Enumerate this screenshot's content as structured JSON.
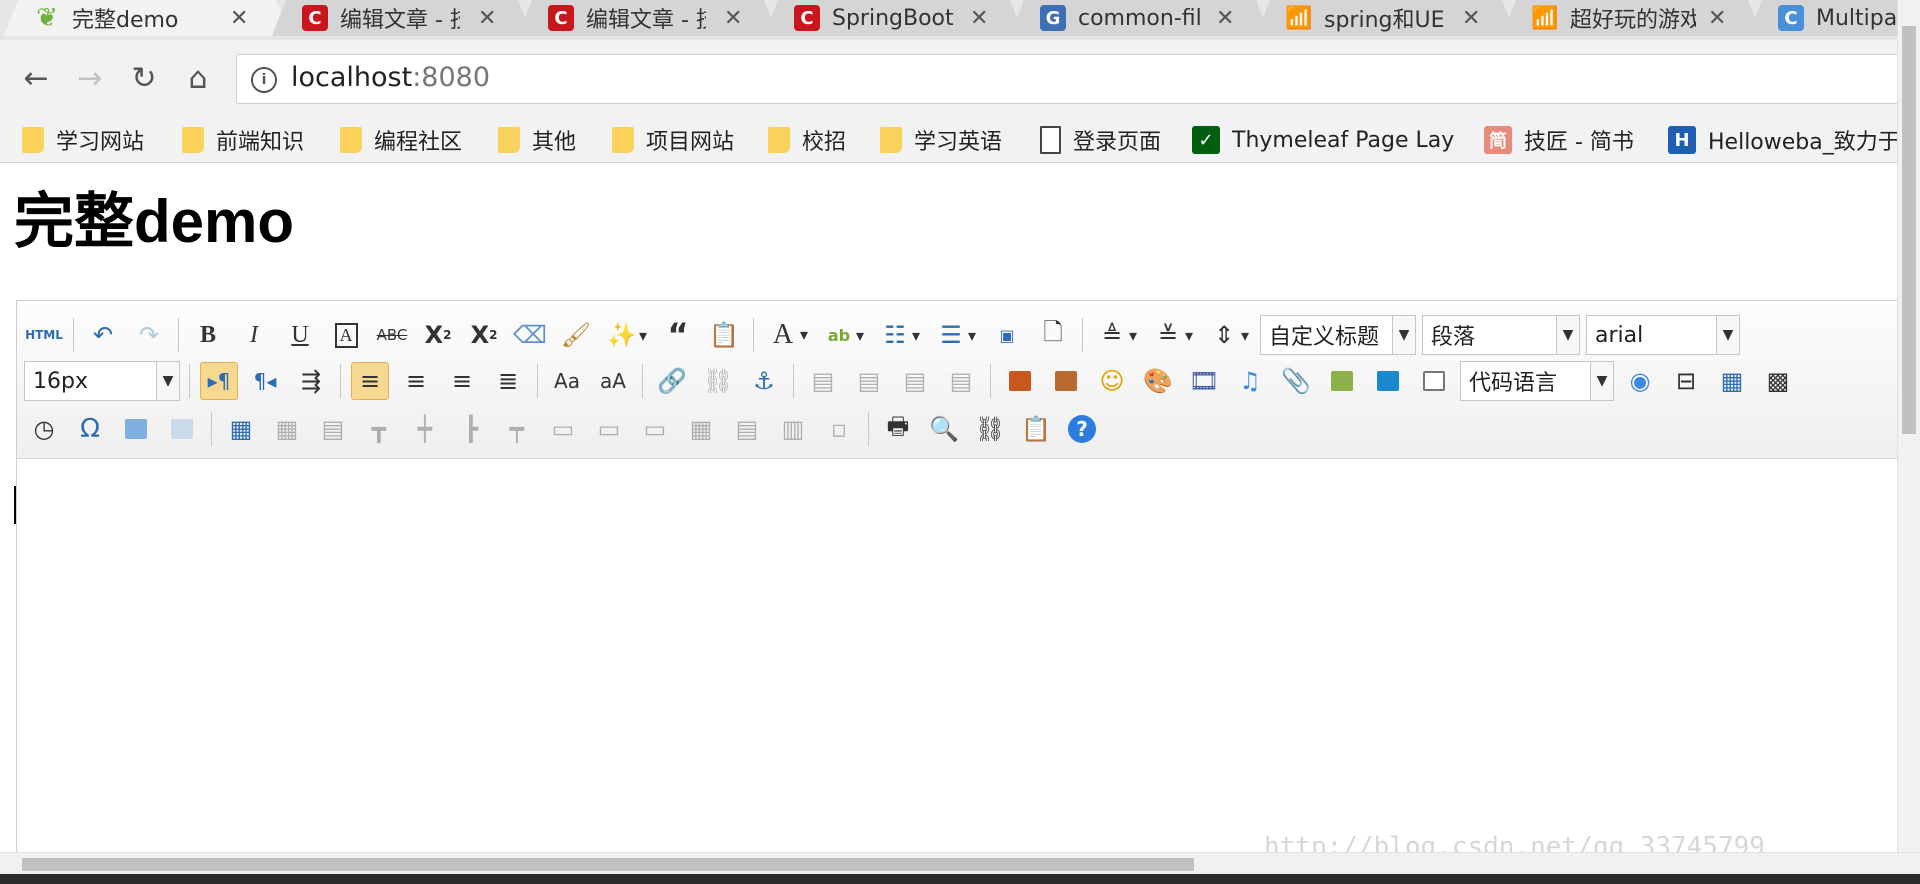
{
  "tabs": [
    {
      "title": "完整demo",
      "favicon": "spring-leaf-icon",
      "color": "#6db33f",
      "active": true
    },
    {
      "title": "编辑文章 - 技",
      "favicon": "csdn-icon",
      "color": "#c8161d"
    },
    {
      "title": "编辑文章 - 技",
      "favicon": "csdn-icon",
      "color": "#c8161d"
    },
    {
      "title": "SpringBoot",
      "favicon": "csdn-icon",
      "color": "#c8161d"
    },
    {
      "title": "common-fil",
      "favicon": "g-icon",
      "color": "#3d6fb5"
    },
    {
      "title": "spring和UE",
      "favicon": "signal-icon",
      "color": "#888888"
    },
    {
      "title": "超好玩的游戏",
      "favicon": "signal-icon",
      "color": "#888888"
    },
    {
      "title": "Multipa",
      "favicon": "c-icon",
      "color": "#4a90d9"
    }
  ],
  "address": {
    "host": "localhost",
    "port": ":8080"
  },
  "bookmarks": [
    {
      "label": "学习网站",
      "icon": "folder"
    },
    {
      "label": "前端知识",
      "icon": "folder"
    },
    {
      "label": "编程社区",
      "icon": "folder"
    },
    {
      "label": "其他",
      "icon": "folder"
    },
    {
      "label": "项目网站",
      "icon": "folder"
    },
    {
      "label": "校招",
      "icon": "folder"
    },
    {
      "label": "学习英语",
      "icon": "folder"
    },
    {
      "label": "登录页面",
      "icon": "page"
    },
    {
      "label": "Thymeleaf Page Lay",
      "icon": "thymeleaf"
    },
    {
      "label": "技匠 - 简书",
      "icon": "jianshu"
    },
    {
      "label": "Helloweba_致力于",
      "icon": "helloweba"
    }
  ],
  "page": {
    "heading": "完整demo"
  },
  "editor": {
    "custom_heading": "自定义标题",
    "paragraph": "段落",
    "font_family": "arial",
    "font_size": "16px",
    "code_language": "代码语言",
    "html_button": "HTML"
  },
  "watermark": "http://blog.csdn.net/qq_33745799"
}
